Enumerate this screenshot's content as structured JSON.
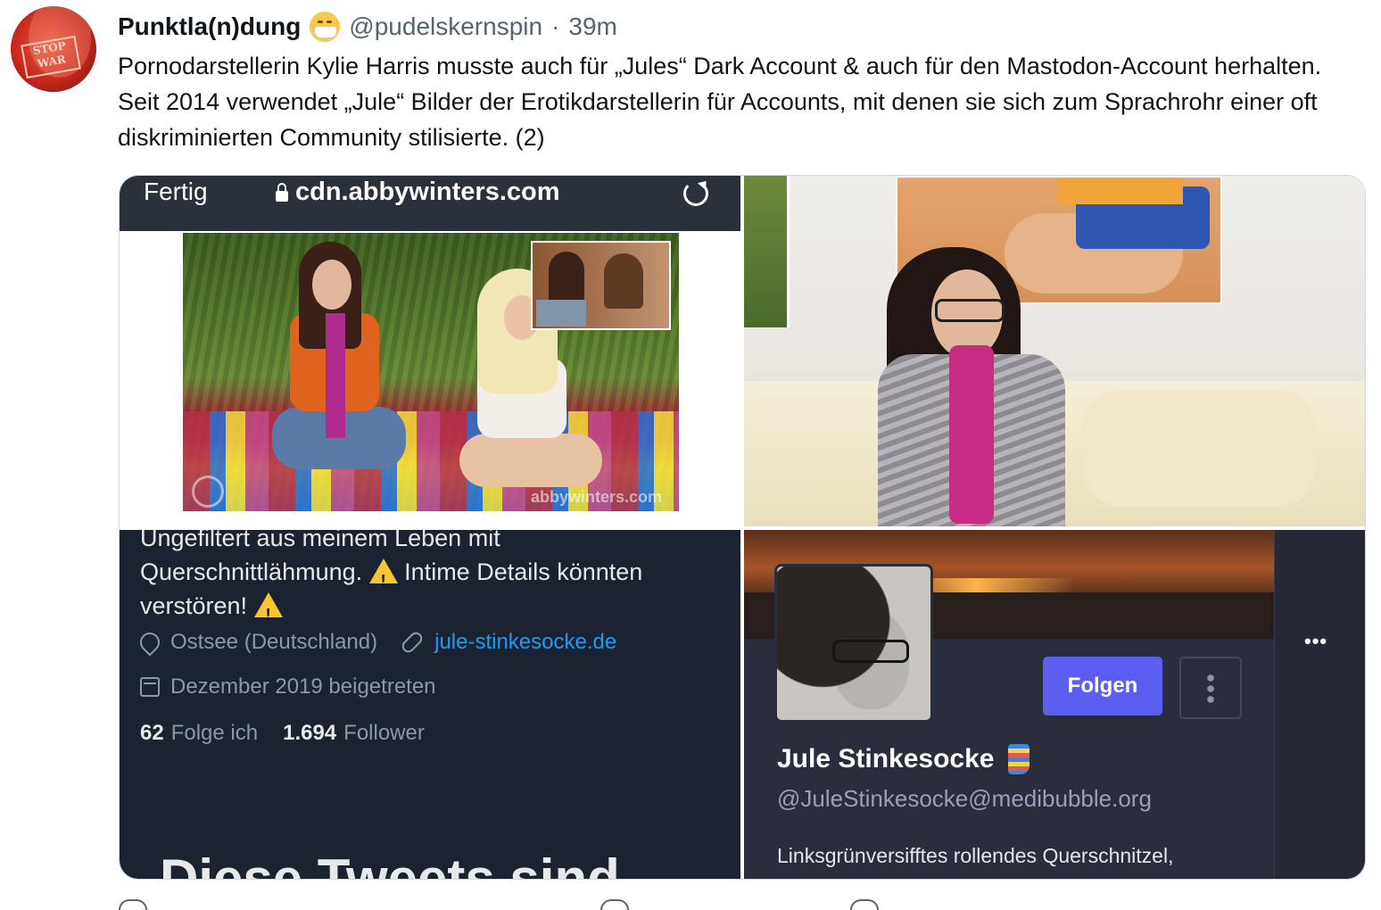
{
  "tweet": {
    "display_name": "Punktla(n)dung",
    "name_emoji_icon": "face-with-medical-mask-icon",
    "handle": "@pudelskernspin",
    "separator": "·",
    "time": "39m",
    "text": "Pornodarstellerin Kylie Harris musste auch für „Jules“ Dark Account & auch für den Mastodon-Account herhalten. Seit 2014 verwendet „Jule“ Bilder der Erotikdarstellerin für Accounts, mit denen sie sich zum Sprachrohr einer oft diskriminierten Community stilisierte. (2)",
    "avatar_text": "STOP WAR"
  },
  "media": {
    "safari": {
      "done_label": "Fertig",
      "url": "cdn.abbywinters.com",
      "watermark": "abbywinters.com"
    },
    "twitter_profile": {
      "bio_line1": "Ungefiltert aus meinem Leben mit",
      "bio_line2": "Querschnittlähmung.",
      "bio_line2b": "Intime Details könnten",
      "bio_line3": "verstören!",
      "location": "Ostsee (Deutschland)",
      "website": "jule-stinkesocke.de",
      "joined": "Dezember 2019 beigetreten",
      "following_count": "62",
      "following_label": "Folge ich",
      "followers_count": "1.694",
      "followers_label": "Follower",
      "cut_heading": "Diese Tweets sind"
    },
    "mastodon_profile": {
      "follow_label": "Folgen",
      "more_label": "•••",
      "name": "Jule Stinkesocke",
      "handle": "@JuleStinkesocke@medibubble.org",
      "bio": "Linksgrünversifftes rollendes Querschnitzel,"
    }
  },
  "colors": {
    "link": "#1d9bf0",
    "mastodon_button": "#5b5ef0",
    "twitter_dark_bg": "#1b2330",
    "mastodon_bg": "#2a2d3b"
  }
}
